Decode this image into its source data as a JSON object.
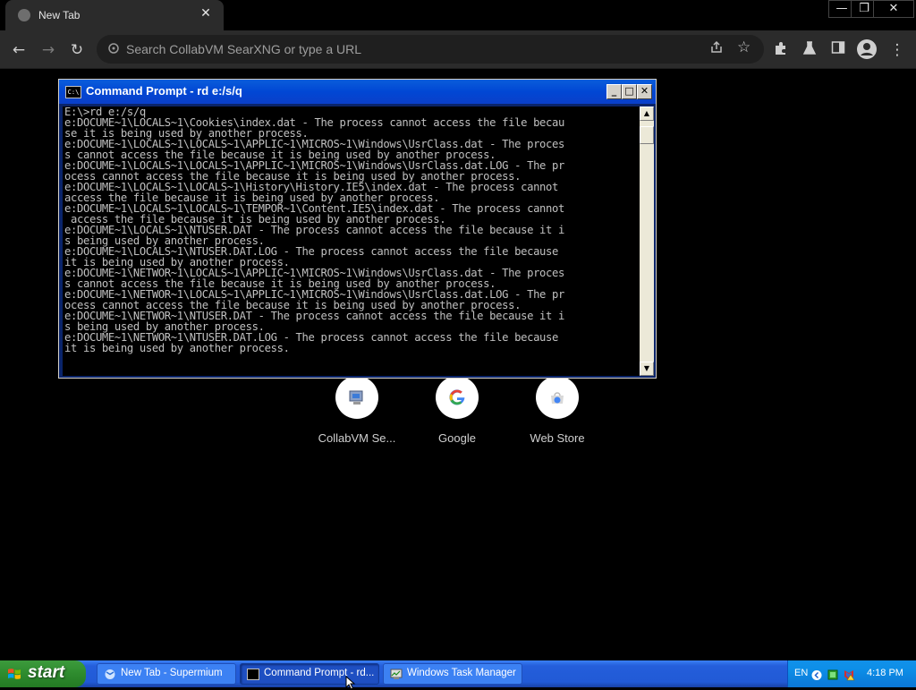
{
  "browser": {
    "tab": {
      "title": "New Tab",
      "close_glyph": "✕"
    },
    "window_controls": {
      "minimize": "—",
      "restore": "❐",
      "close": "✕"
    },
    "toolbar": {
      "back_glyph": "←",
      "forward_glyph": "→",
      "reload_glyph": "↻",
      "omnibox_placeholder": "Search CollabVM SearXNG or type a URL",
      "menu_glyph": "⋮"
    }
  },
  "shortcuts": [
    {
      "label": "CollabVM Se...",
      "icon": "collabvm-icon"
    },
    {
      "label": "Google",
      "icon": "google-icon",
      "glyph": "G"
    },
    {
      "label": "Web Store",
      "icon": "web-store-icon"
    }
  ],
  "cmd": {
    "title": "Command Prompt - rd e:/s/q",
    "icon_text": "C:\\",
    "output": "E:\\>rd e:/s/q\ne:DOCUME~1\\LOCALS~1\\Cookies\\index.dat - The process cannot access the file becau\nse it is being used by another process.\ne:DOCUME~1\\LOCALS~1\\LOCALS~1\\APPLIC~1\\MICROS~1\\Windows\\UsrClass.dat - The proces\ns cannot access the file because it is being used by another process.\ne:DOCUME~1\\LOCALS~1\\LOCALS~1\\APPLIC~1\\MICROS~1\\Windows\\UsrClass.dat.LOG - The pr\nocess cannot access the file because it is being used by another process.\ne:DOCUME~1\\LOCALS~1\\LOCALS~1\\History\\History.IE5\\index.dat - The process cannot\naccess the file because it is being used by another process.\ne:DOCUME~1\\LOCALS~1\\LOCALS~1\\TEMPOR~1\\Content.IE5\\index.dat - The process cannot\n access the file because it is being used by another process.\ne:DOCUME~1\\LOCALS~1\\NTUSER.DAT - The process cannot access the file because it i\ns being used by another process.\ne:DOCUME~1\\LOCALS~1\\NTUSER.DAT.LOG - The process cannot access the file because\nit is being used by another process.\ne:DOCUME~1\\NETWOR~1\\LOCALS~1\\APPLIC~1\\MICROS~1\\Windows\\UsrClass.dat - The proces\ns cannot access the file because it is being used by another process.\ne:DOCUME~1\\NETWOR~1\\LOCALS~1\\APPLIC~1\\MICROS~1\\Windows\\UsrClass.dat.LOG - The pr\nocess cannot access the file because it is being used by another process.\ne:DOCUME~1\\NETWOR~1\\NTUSER.DAT - The process cannot access the file because it i\ns being used by another process.\ne:DOCUME~1\\NETWOR~1\\NTUSER.DAT.LOG - The process cannot access the file because\nit is being used by another process."
  },
  "taskbar": {
    "start_label": "start",
    "tasks": [
      {
        "label": "New Tab - Supermium"
      },
      {
        "label": "Command Prompt - rd..."
      },
      {
        "label": "Windows Task Manager"
      }
    ],
    "tray": {
      "language": "EN",
      "clock": "4:18 PM"
    }
  },
  "colors": {
    "cmd_titlebar": "#0147d4",
    "taskbar": "#245edb",
    "start_button": "#2e8b2e",
    "tray": "#0d8fe8"
  }
}
